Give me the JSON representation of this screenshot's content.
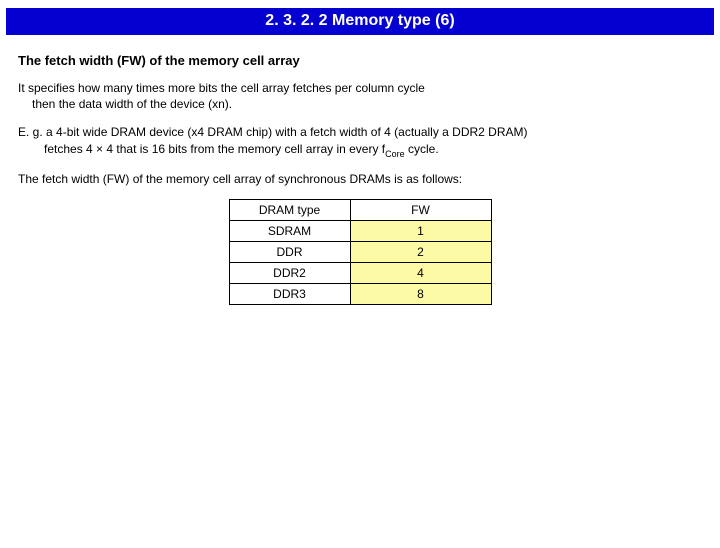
{
  "title": "2. 3. 2. 2 Memory type (6)",
  "heading": "The fetch width (FW) of the memory cell array",
  "p1_line1": "It specifies how many times more bits the cell array fetches per column cycle",
  "p1_line2": "then the data width of the device (xn).",
  "p2_line1": "E. g. a 4-bit wide DRAM device (x4 DRAM chip) with a fetch width of 4 (actually a DDR2 DRAM)",
  "p2_line2a": "fetches 4 × 4 that is 16 bits from the memory cell array in every f",
  "p2_sub": "Core",
  "p2_line2b": " cycle.",
  "p3": "The fetch width (FW) of the memory cell array of synchronous DRAMs is as follows:",
  "table": {
    "head": {
      "col1": "DRAM type",
      "col2": "FW"
    },
    "rows": [
      {
        "type": "SDRAM",
        "fw": "1"
      },
      {
        "type": "DDR",
        "fw": "2"
      },
      {
        "type": "DDR2",
        "fw": "4"
      },
      {
        "type": "DDR3",
        "fw": "8"
      }
    ]
  },
  "chart_data": {
    "type": "table",
    "title": "Fetch width by DRAM type",
    "columns": [
      "DRAM type",
      "FW"
    ],
    "rows": [
      [
        "SDRAM",
        1
      ],
      [
        "DDR",
        2
      ],
      [
        "DDR2",
        4
      ],
      [
        "DDR3",
        8
      ]
    ]
  }
}
